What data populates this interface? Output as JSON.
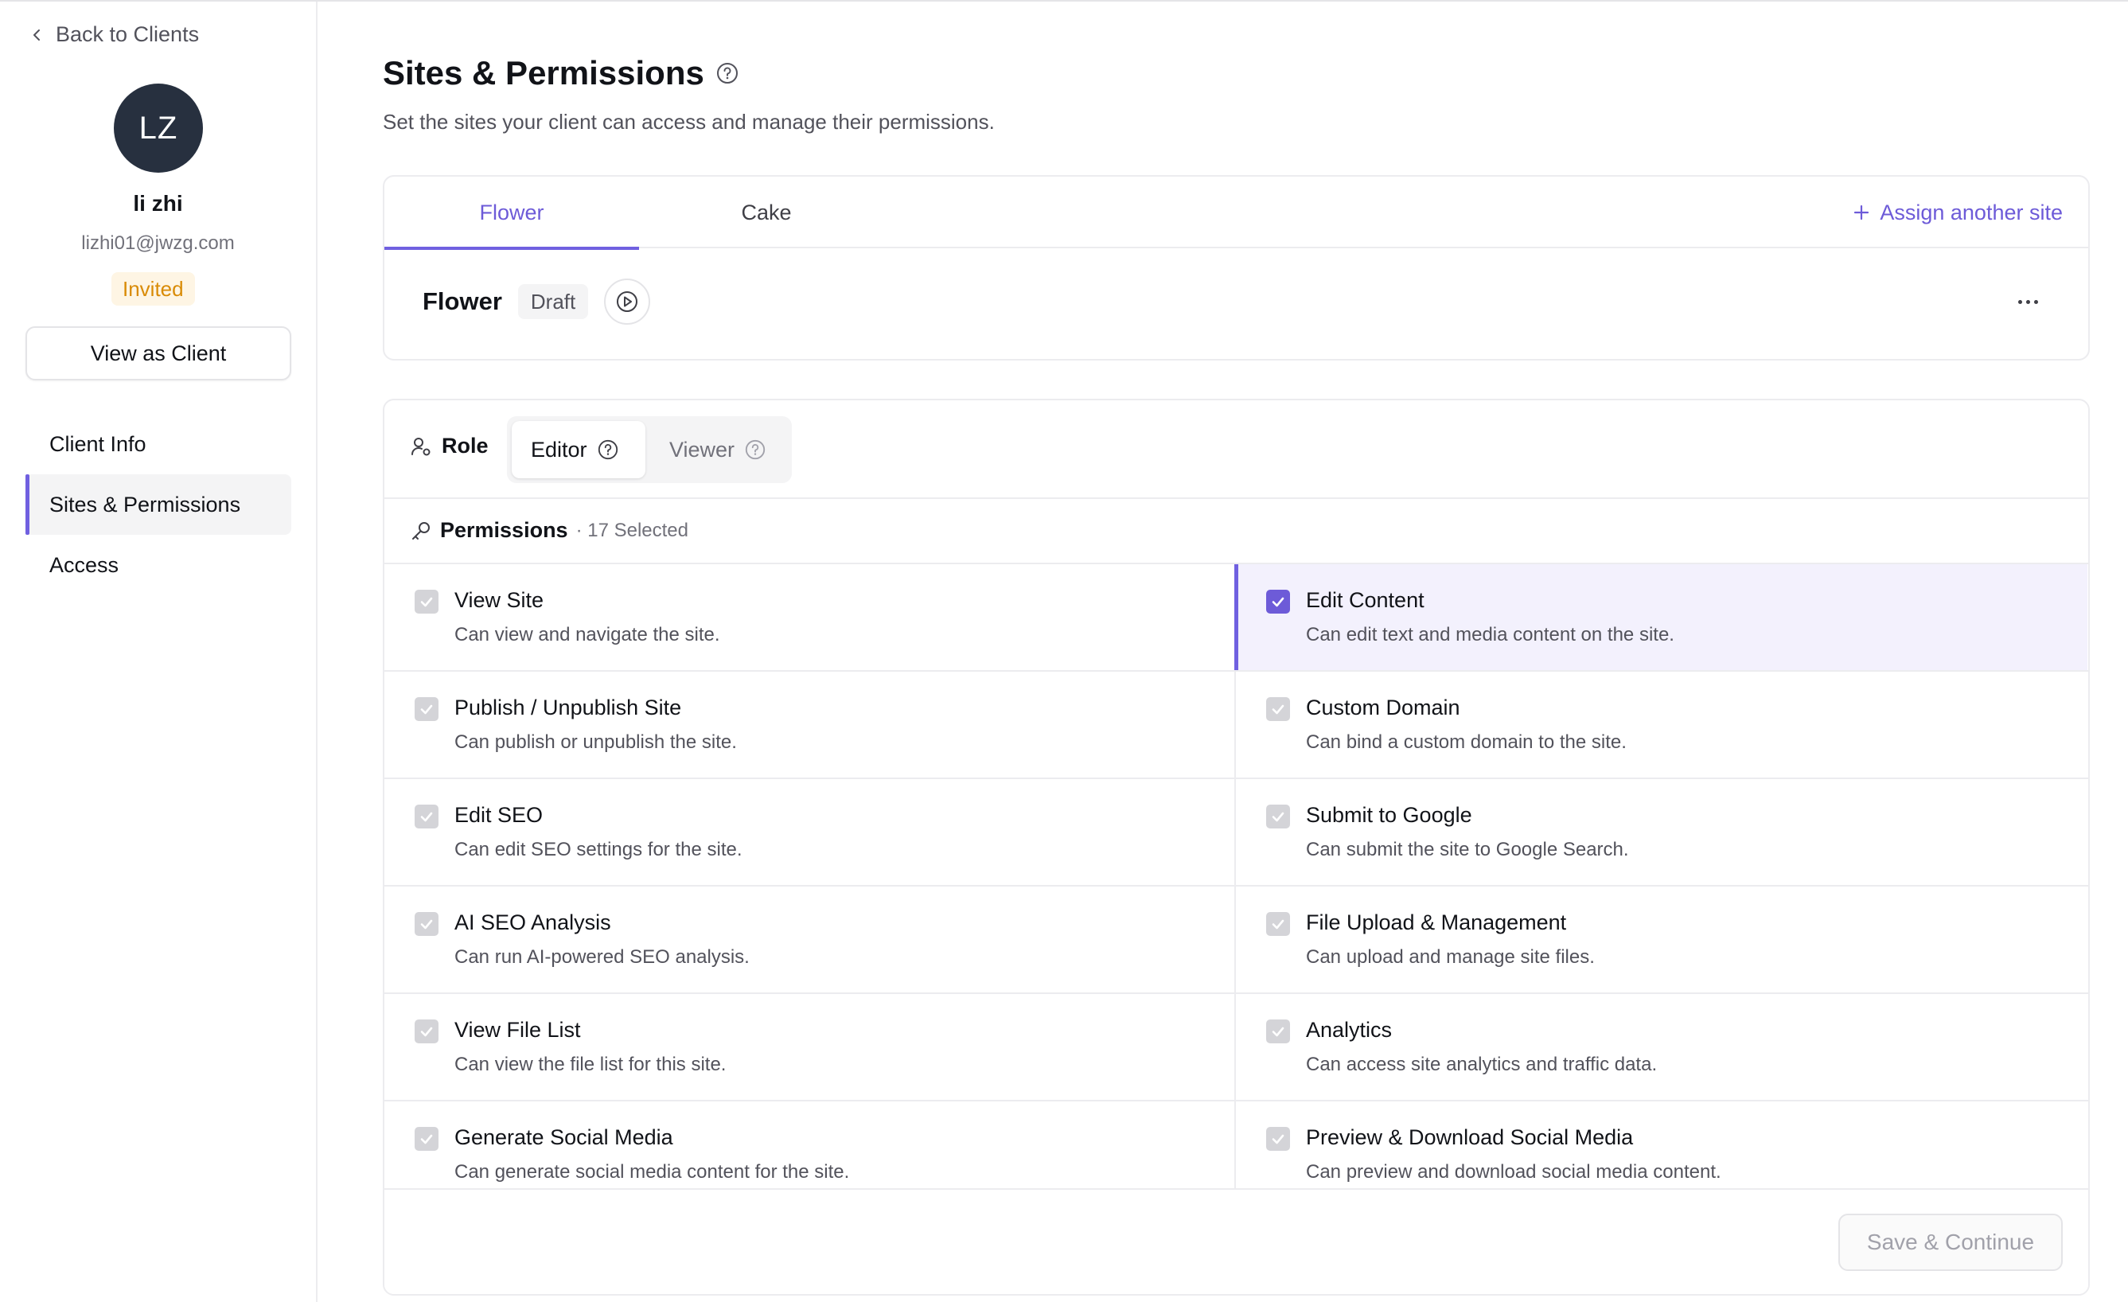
{
  "sidebar": {
    "back_label": "Back to Clients",
    "avatar_initials": "LZ",
    "client_name": "li zhi",
    "client_email": "lizhi01@jwzg.com",
    "status_badge": "Invited",
    "view_as_client_label": "View as Client",
    "nav": [
      {
        "label": "Client Info",
        "active": false
      },
      {
        "label": "Sites & Permissions",
        "active": true
      },
      {
        "label": "Access",
        "active": false
      }
    ]
  },
  "main": {
    "title": "Sites & Permissions",
    "subtitle": "Set the sites your client can access and manage their permissions.",
    "tabs": [
      {
        "label": "Flower",
        "active": true
      },
      {
        "label": "Cake",
        "active": false
      }
    ],
    "assign_label": "Assign another site",
    "site": {
      "name": "Flower",
      "status": "Draft"
    },
    "role": {
      "label": "Role",
      "options": [
        {
          "label": "Editor",
          "active": true
        },
        {
          "label": "Viewer",
          "active": false
        }
      ]
    },
    "permissions": {
      "label": "Permissions",
      "count_text": "· 17 Selected",
      "rows": [
        [
          {
            "title": "View Site",
            "desc": "Can view and navigate the site.",
            "checked": true,
            "selected": false
          },
          {
            "title": "Edit Content",
            "desc": "Can edit text and media content on the site.",
            "checked": true,
            "selected": true
          }
        ],
        [
          {
            "title": "Publish / Unpublish Site",
            "desc": "Can publish or unpublish the site.",
            "checked": true,
            "selected": false
          },
          {
            "title": "Custom Domain",
            "desc": "Can bind a custom domain to the site.",
            "checked": true,
            "selected": false
          }
        ],
        [
          {
            "title": "Edit SEO",
            "desc": "Can edit SEO settings for the site.",
            "checked": true,
            "selected": false
          },
          {
            "title": "Submit to Google",
            "desc": "Can submit the site to Google Search.",
            "checked": true,
            "selected": false
          }
        ],
        [
          {
            "title": "AI SEO Analysis",
            "desc": "Can run AI-powered SEO analysis.",
            "checked": true,
            "selected": false
          },
          {
            "title": "File Upload & Management",
            "desc": "Can upload and manage site files.",
            "checked": true,
            "selected": false
          }
        ],
        [
          {
            "title": "View File List",
            "desc": "Can view the file list for this site.",
            "checked": true,
            "selected": false
          },
          {
            "title": "Analytics",
            "desc": "Can access site analytics and traffic data.",
            "checked": true,
            "selected": false
          }
        ],
        [
          {
            "title": "Generate Social Media",
            "desc": "Can generate social media content for the site.",
            "checked": true,
            "selected": false
          },
          {
            "title": "Preview & Download Social Media",
            "desc": "Can preview and download social media content.",
            "checked": true,
            "selected": false
          }
        ]
      ]
    },
    "save_label": "Save & Continue"
  },
  "colors": {
    "accent": "#6d5bd8",
    "avatar_bg": "#27303f",
    "invited_text": "#d98b06",
    "invited_bg": "#fef5e4",
    "selected_row_bg": "#f3f1fd"
  }
}
